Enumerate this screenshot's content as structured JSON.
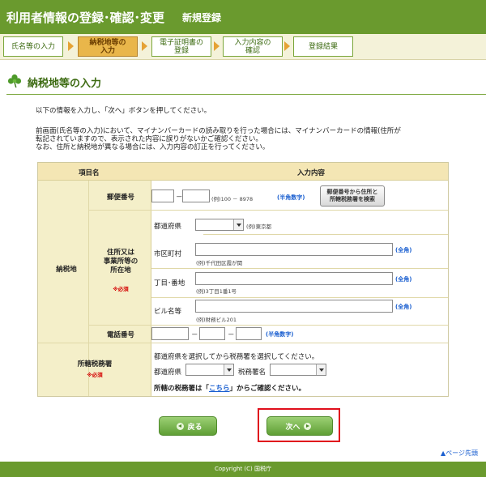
{
  "header": {
    "title": "利用者情報の登録･確認･変更",
    "subtitle": "新規登録"
  },
  "steps": [
    {
      "line1": "氏名等の入力",
      "line2": ""
    },
    {
      "line1": "納税地等の",
      "line2": "入力"
    },
    {
      "line1": "電子証明書の",
      "line2": "登録"
    },
    {
      "line1": "入力内容の",
      "line2": "確認"
    },
    {
      "line1": "登録結果",
      "line2": ""
    }
  ],
  "section": {
    "title": "納税地等の入力"
  },
  "intro": {
    "line1": "以下の情報を入力し、「次へ」ボタンを押してください。",
    "line2": "前画面(氏名等の入力)において、マイナンバーカードの読み取りを行った場合には、マイナンバーカードの情報(住所が",
    "line3": "転記されていますので、表示された内容に誤りがないかご確認ください。",
    "line4": "なお、住所と納税地が異なる場合には、入力内容の訂正を行ってください。"
  },
  "form": {
    "col_item": "項目名",
    "col_content": "入力内容",
    "nozeichi": "納税地",
    "postal": {
      "label": "郵便番号",
      "example": "(例)100 － 8978",
      "note": "(半角数字)",
      "search_line1": "郵便番号から住所と",
      "search_line2": "所轄税務署を検索"
    },
    "address": {
      "label_line1": "住所又は",
      "label_line2": "事業所等の",
      "label_line3": "所在地",
      "required": "※必須",
      "pref_label": "都道府県",
      "pref_example": "(例)東京都",
      "city_label": "市区町村",
      "city_example": "(例)千代田区霞が関",
      "zenkaku": "(全角)",
      "chome_label": "丁目･番地",
      "chome_example": "(例)3丁目1番1号",
      "bldg_label": "ビル名等",
      "bldg_example": "(例)財務ビル201"
    },
    "phone": {
      "label": "電話番号",
      "note": "(半角数字)"
    },
    "tax_office": {
      "label": "所轄税務署",
      "required": "※必須",
      "instruction": "都道府県を選択してから税務署を選択してください。",
      "pref_label": "都道府県",
      "office_label": "税務署名",
      "note_pre": "所轄の税務署は「",
      "note_link": "こちら",
      "note_post": "」からご確認ください。"
    }
  },
  "buttons": {
    "back": "戻る",
    "next": "次へ"
  },
  "page_top": "ページ先頭",
  "footer": "Copyright (C) 国税庁",
  "colors": {
    "brand_green": "#6a9a2e",
    "active_step": "#e9b64a",
    "highlight_red": "#e0101c",
    "link_blue": "#1a5fd0"
  }
}
